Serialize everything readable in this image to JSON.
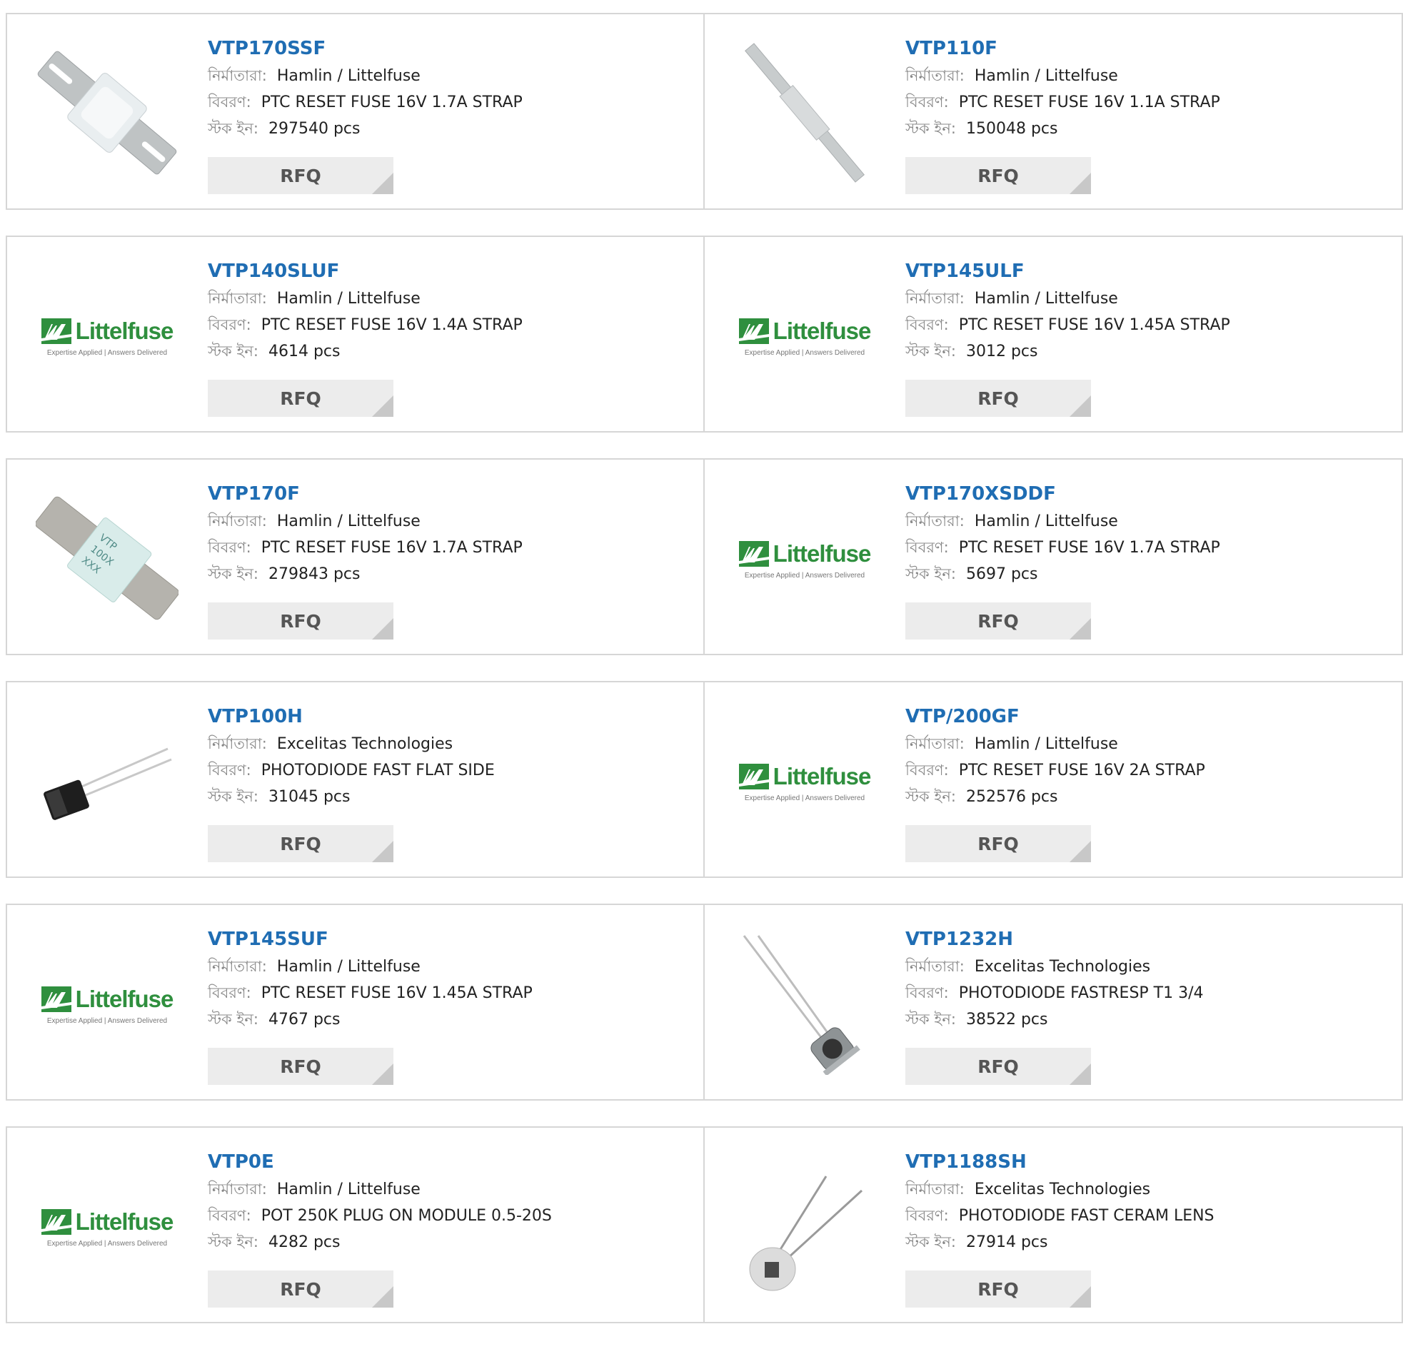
{
  "labels": {
    "manufacturer": "নির্মাতারা:",
    "description": "বিবরণ:",
    "stock": "স্টক ইন:",
    "rfq": "RFQ"
  },
  "logo": {
    "word": "Littelfuse",
    "tagline": "Expertise Applied | Answers Delivered"
  },
  "products": [
    {
      "part": "VTP170SSF",
      "manufacturer": "Hamlin / Littelfuse",
      "description": "PTC RESET FUSE 16V 1.7A STRAP",
      "stock": "297540 pcs",
      "image": "fuse-strap-wide-icon"
    },
    {
      "part": "VTP110F",
      "manufacturer": "Hamlin / Littelfuse",
      "description": "PTC RESET FUSE 16V 1.1A STRAP",
      "stock": "150048 pcs",
      "image": "fuse-strap-thin-icon"
    },
    {
      "part": "VTP140SLUF",
      "manufacturer": "Hamlin / Littelfuse",
      "description": "PTC RESET FUSE 16V 1.4A STRAP",
      "stock": "4614 pcs",
      "image": "littelfuse-logo"
    },
    {
      "part": "VTP145ULF",
      "manufacturer": "Hamlin / Littelfuse",
      "description": "PTC RESET FUSE 16V 1.45A STRAP",
      "stock": "3012 pcs",
      "image": "littelfuse-logo"
    },
    {
      "part": "VTP170F",
      "manufacturer": "Hamlin / Littelfuse",
      "description": "PTC RESET FUSE 16V 1.7A STRAP",
      "stock": "279843 pcs",
      "image": "fuse-strap-label-icon"
    },
    {
      "part": "VTP170XSDDF",
      "manufacturer": "Hamlin / Littelfuse",
      "description": "PTC RESET FUSE 16V 1.7A STRAP",
      "stock": "5697 pcs",
      "image": "littelfuse-logo"
    },
    {
      "part": "VTP100H",
      "manufacturer": "Excelitas Technologies",
      "description": "PHOTODIODE FAST FLAT SIDE",
      "stock": "31045 pcs",
      "image": "photodiode-flat-icon"
    },
    {
      "part": "VTP/200GF",
      "manufacturer": "Hamlin / Littelfuse",
      "description": "PTC RESET FUSE 16V 2A STRAP",
      "stock": "252576 pcs",
      "image": "littelfuse-logo"
    },
    {
      "part": "VTP145SUF",
      "manufacturer": "Hamlin / Littelfuse",
      "description": "PTC RESET FUSE 16V 1.45A STRAP",
      "stock": "4767 pcs",
      "image": "littelfuse-logo"
    },
    {
      "part": "VTP1232H",
      "manufacturer": "Excelitas Technologies",
      "description": "PHOTODIODE FASTRESP T1 3/4",
      "stock": "38522 pcs",
      "image": "photodiode-lens-icon"
    },
    {
      "part": "VTP0E",
      "manufacturer": "Hamlin / Littelfuse",
      "description": "POT 250K PLUG ON MODULE 0.5-20S",
      "stock": "4282 pcs",
      "image": "littelfuse-logo"
    },
    {
      "part": "VTP1188SH",
      "manufacturer": "Excelitas Technologies",
      "description": "PHOTODIODE FAST CERAM LENS",
      "stock": "27914 pcs",
      "image": "photodiode-ceramic-icon"
    }
  ]
}
